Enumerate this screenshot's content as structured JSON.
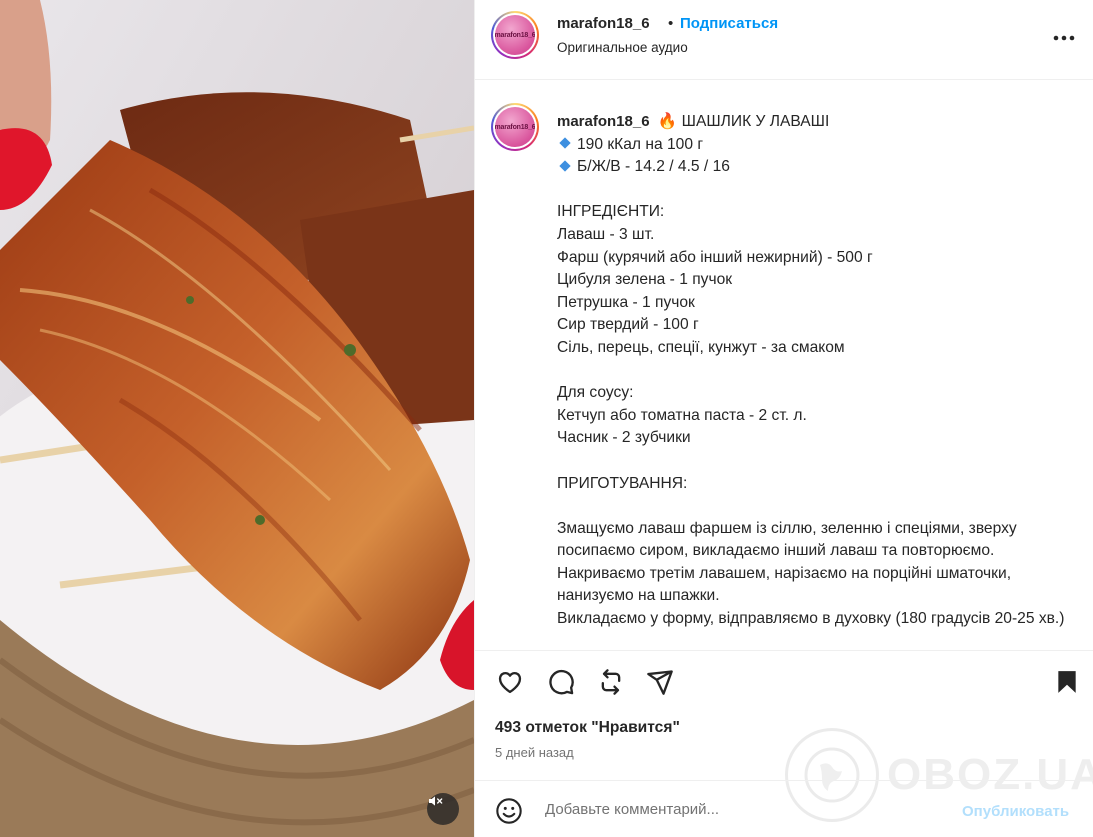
{
  "post": {
    "username": "marafon18_6",
    "avatar_text": "marafon18_6",
    "follow_label": "Подписаться",
    "dot": "•",
    "audio_label": "Оригинальное аудио"
  },
  "caption": {
    "username": "marafon18_6",
    "title": "ШАШЛИК У ЛАВАШІ",
    "kcal": "190 кКал на 100 г",
    "bju": "Б/Ж/В - 14.2 / 4.5 / 16",
    "body": "ІНГРЕДІЄНТИ:\nЛаваш - 3 шт.\nФарш (курячий або інший нежирний) - 500 г\nЦибуля зелена - 1 пучок\nПетрушка - 1 пучок\nСир твердий - 100 г\nСіль, перець, спеції, кунжут - за смаком\n\nДля соусу:\nКетчуп або томатна паста - 2 ст. л.\nЧасник - 2 зубчики\n\nПРИГОТУВАННЯ:\n\nЗмащуємо лаваш фаршем із сіллю, зеленню і спеціями, зверху посипаємо сиром, викладаємо інший лаваш та повторюємо.\nНакриваємо третім лавашем, нарізаємо на порційні шматочки, нанизуємо на шпажки.\nВикладаємо у форму, відправляємо в духовку (180 градусів 20-25 хв.)"
  },
  "stats": {
    "likes": "493 отметок \"Нравится\"",
    "time_ago": "5 дней назад"
  },
  "comment": {
    "placeholder": "Добавьте комментарий...",
    "publish_label": "Опубликовать"
  },
  "watermark": {
    "text": "OBOZ.UA"
  },
  "icons": {
    "like": "heart-icon",
    "comment": "comment-icon",
    "share": "repost-icon",
    "send": "send-icon",
    "save": "bookmark-icon",
    "emoji": "emoji-icon",
    "more": "more-icon",
    "mute": "muted-speaker-icon"
  },
  "colors": {
    "accent": "#0095f6",
    "publish_disabled": "#b2dffc",
    "text": "#262626",
    "secondary": "#737373"
  }
}
